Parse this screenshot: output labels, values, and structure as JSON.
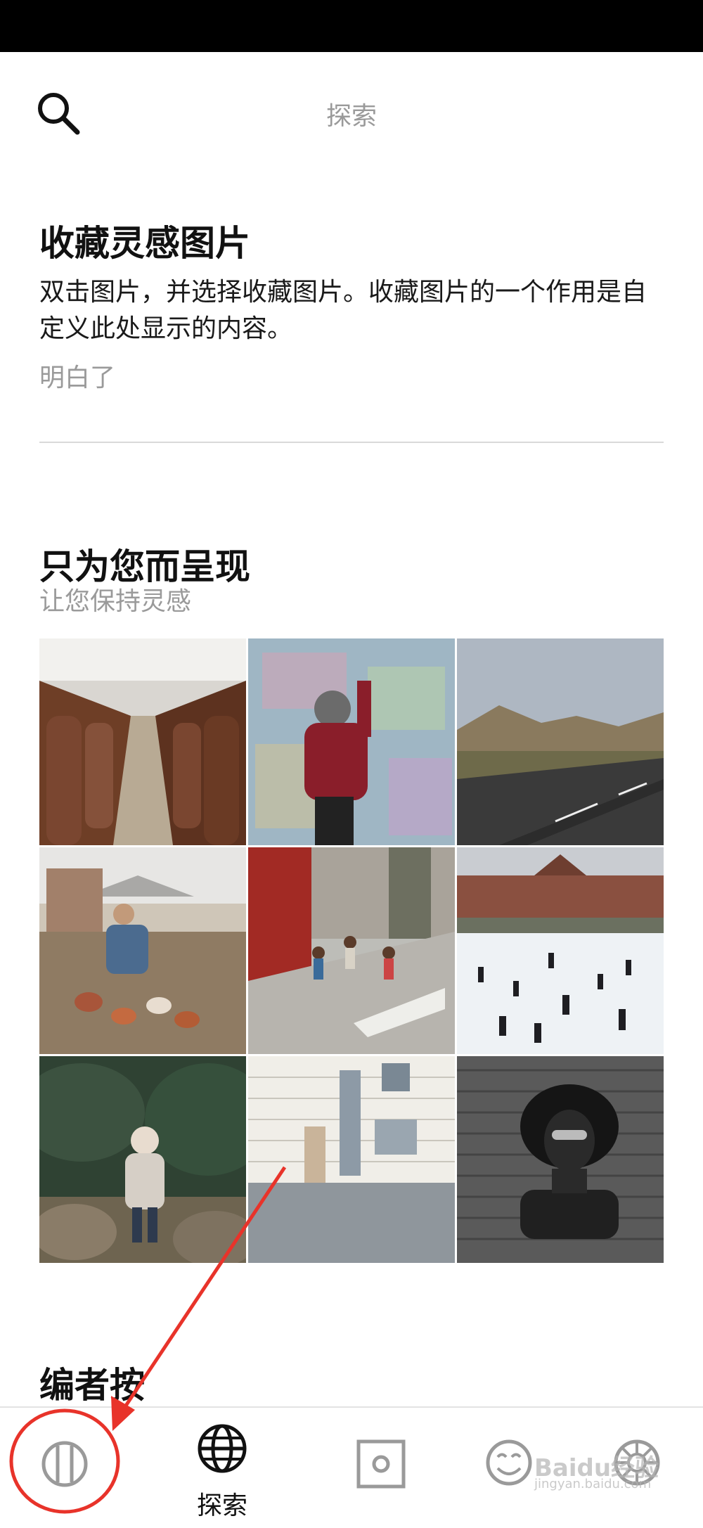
{
  "header": {
    "title": "探索"
  },
  "tip": {
    "title": "收藏灵感图片",
    "body": "双击图片，并选择收藏图片。收藏图片的一个作用是自定义此处显示的内容。",
    "dismiss": "明白了"
  },
  "for_you": {
    "title": "只为您而呈现",
    "subtitle": "让您保持灵感"
  },
  "section2": {
    "title_partial": "编者按"
  },
  "tabbar": {
    "tabs": [
      {
        "icon": "circle-stripes-icon",
        "label": ""
      },
      {
        "icon": "globe-icon",
        "label": "探索"
      },
      {
        "icon": "square-dot-icon",
        "label": ""
      },
      {
        "icon": "smiley-icon",
        "label": ""
      },
      {
        "icon": "aperture-icon",
        "label": ""
      }
    ]
  },
  "watermark": {
    "text": "Baidu经验",
    "sub": "jingyan.baidu.com"
  },
  "colors": {
    "annotation": "#e8332a",
    "status_bar": "#000000"
  }
}
